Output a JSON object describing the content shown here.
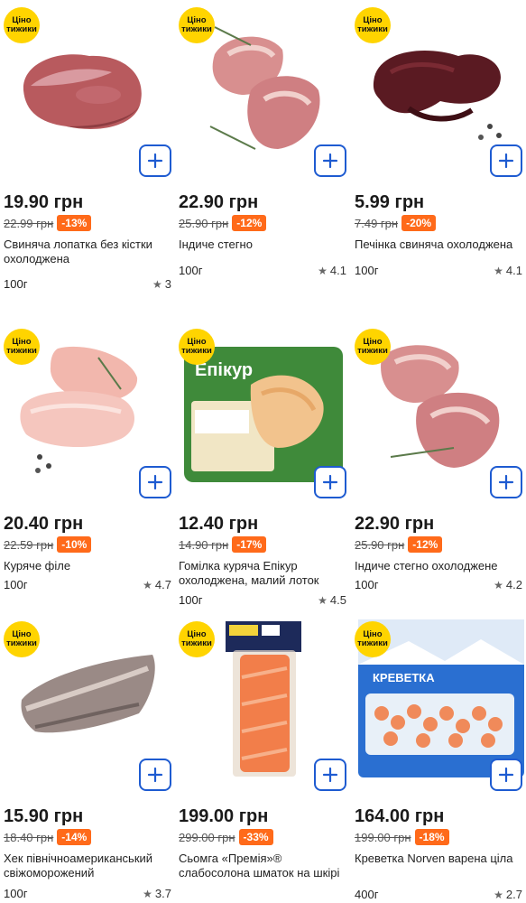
{
  "badge": {
    "line1": "Ціно",
    "line2": "тижики",
    "color": "#ffd400"
  },
  "add_button": {
    "icon": "plus-icon",
    "color": "#1e5bd1"
  },
  "discount_color": "#ff6a1a",
  "products": [
    {
      "price": "19.90 грн",
      "old_price": "22.99 грн",
      "discount": "-13%",
      "name": "Свиняча лопатка без кістки охолоджена",
      "weight": "100г",
      "rating": "3",
      "image": "pork-shoulder"
    },
    {
      "price": "22.90 грн",
      "old_price": "25.90 грн",
      "discount": "-12%",
      "name": "Індиче стегно",
      "weight": "100г",
      "rating": "4.1",
      "image": "turkey-thigh"
    },
    {
      "price": "5.99 грн",
      "old_price": "7.49 грн",
      "discount": "-20%",
      "name": "Печінка свиняча охолоджена",
      "weight": "100г",
      "rating": "4.1",
      "image": "pork-liver"
    },
    {
      "price": "20.40 грн",
      "old_price": "22.59 грн",
      "discount": "-10%",
      "name": "Куряче філе",
      "weight": "100г",
      "rating": "4.7",
      "image": "chicken-fillet"
    },
    {
      "price": "12.40 грн",
      "old_price": "14.90 грн",
      "discount": "-17%",
      "name": "Гомілка куряча Епікур охолоджена, малий лоток",
      "weight": "100г",
      "rating": "4.5",
      "image": "chicken-drumstick-tray",
      "package_brand": "Епікур"
    },
    {
      "price": "22.90 грн",
      "old_price": "25.90 грн",
      "discount": "-12%",
      "name": "Індиче стегно охолоджене",
      "weight": "100г",
      "rating": "4.2",
      "image": "turkey-thigh-chilled"
    },
    {
      "price": "15.90 грн",
      "old_price": "18.40 грн",
      "discount": "-14%",
      "name": "Хек північноамериканський свіжоморожений",
      "weight": "100г",
      "rating": "3.7",
      "image": "hake-fish"
    },
    {
      "price": "199.00 грн",
      "old_price": "299.00 грн",
      "discount": "-33%",
      "name": "Сьомга «Премія»® слабосолона шматок на шкірі",
      "weight": "",
      "rating": "",
      "image": "salmon-pack"
    },
    {
      "price": "164.00 грн",
      "old_price": "199.00 грн",
      "discount": "-18%",
      "name": "Креветка Norven варена ціла",
      "weight": "400г",
      "rating": "2.7",
      "image": "shrimp-pack",
      "package_title": "КРЕВЕТКА"
    }
  ]
}
